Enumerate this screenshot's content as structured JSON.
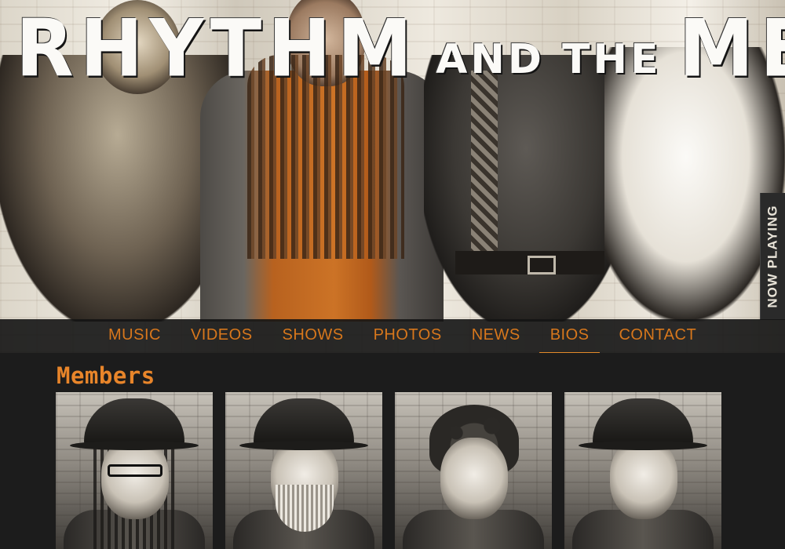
{
  "header": {
    "logo": {
      "word1": "RHYTHM",
      "word2": "AND",
      "word3": "THE",
      "word4": "METHOD"
    },
    "now_playing": "NOW PLAYING"
  },
  "nav": {
    "items": [
      {
        "label": "MUSIC",
        "active": false
      },
      {
        "label": "VIDEOS",
        "active": false
      },
      {
        "label": "SHOWS",
        "active": false
      },
      {
        "label": "PHOTOS",
        "active": false
      },
      {
        "label": "NEWS",
        "active": false
      },
      {
        "label": "BIOS",
        "active": true
      },
      {
        "label": "CONTACT",
        "active": false
      }
    ]
  },
  "main": {
    "section_title": "Members"
  },
  "colors": {
    "accent": "#d7771c",
    "background": "#1c1c1c",
    "nav_bg": "#141414"
  }
}
